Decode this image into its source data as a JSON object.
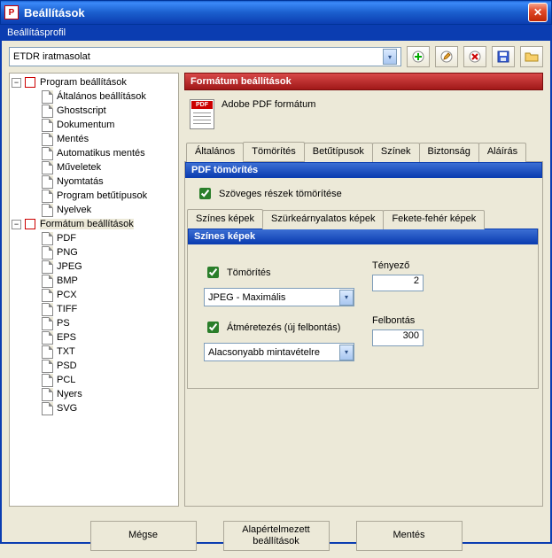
{
  "window": {
    "title": "Beállítások"
  },
  "profile": {
    "label": "Beállításprofil",
    "selected": "ETDR iratmasolat"
  },
  "toolbar_icons": [
    "add-profile",
    "edit-profile",
    "delete-profile",
    "save-profile",
    "open-folder"
  ],
  "tree": {
    "root1": {
      "label": "Program beállítások"
    },
    "r1_items": [
      "Általános beállítások",
      "Ghostscript",
      "Dokumentum",
      "Mentés",
      "Automatikus mentés",
      "Műveletek",
      "Nyomtatás",
      "Program betűtípusok",
      "Nyelvek"
    ],
    "root2": {
      "label": "Formátum beállítások"
    },
    "r2_items": [
      "PDF",
      "PNG",
      "JPEG",
      "BMP",
      "PCX",
      "TIFF",
      "PS",
      "EPS",
      "TXT",
      "PSD",
      "PCL",
      "Nyers",
      "SVG"
    ]
  },
  "right": {
    "header": "Formátum beállítások",
    "format_name": "Adobe PDF formátum",
    "tabs": [
      "Általános",
      "Tömörítés",
      "Betűtípusok",
      "Színek",
      "Biztonság",
      "Aláírás"
    ],
    "active_tab": 1,
    "sub_header": "PDF tömörítés",
    "text_compress": "Szöveges részek tömörítése",
    "img_tabs": [
      "Színes képek",
      "Szürkeárnyalatos képek",
      "Fekete-fehér képek"
    ],
    "active_img_tab": 0,
    "group_title": "Színes képek",
    "compress_cb": "Tömörítés",
    "compress_val": "JPEG - Maximális",
    "factor_label": "Tényező",
    "factor_val": "2",
    "resample_cb": "Átméretezés (új felbontás)",
    "resample_val": "Alacsonyabb mintavételre",
    "res_label": "Felbontás",
    "res_val": "300"
  },
  "buttons": {
    "cancel": "Mégse",
    "defaults": "Alapértelmezett beállítások",
    "save": "Mentés"
  }
}
